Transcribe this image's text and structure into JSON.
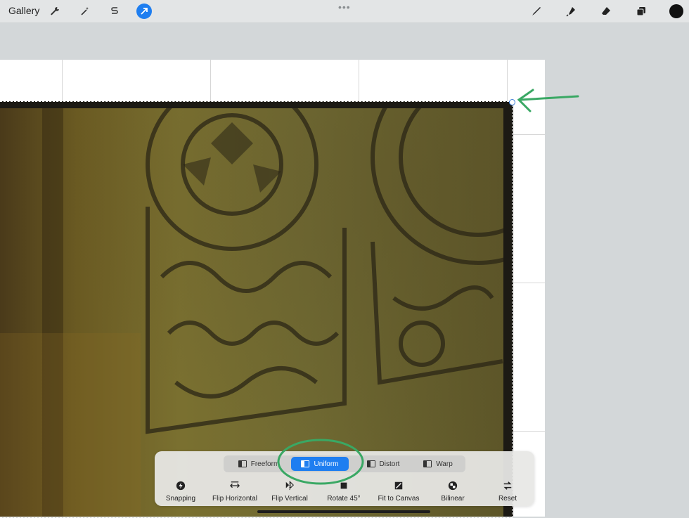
{
  "topbar": {
    "gallery_label": "Gallery",
    "left_icons": [
      "wrench-icon",
      "magic-wand-icon",
      "selection-s-icon",
      "transform-arrow-icon"
    ],
    "center_handle": "•••",
    "right_icons": [
      "brush-icon",
      "smudge-icon",
      "eraser-icon",
      "layers-icon"
    ],
    "color_swatch": "#111111",
    "accent": "#1e7ef0"
  },
  "transform": {
    "modes": [
      {
        "label": "Freeform",
        "active": false
      },
      {
        "label": "Uniform",
        "active": true
      },
      {
        "label": "Distort",
        "active": false
      },
      {
        "label": "Warp",
        "active": false
      }
    ],
    "tools": [
      {
        "label": "Snapping",
        "icon": "lightning-icon"
      },
      {
        "label": "Flip Horizontal",
        "icon": "flip-horizontal-icon"
      },
      {
        "label": "Flip Vertical",
        "icon": "flip-vertical-icon"
      },
      {
        "label": "Rotate 45°",
        "icon": "rotate-icon"
      },
      {
        "label": "Fit to Canvas",
        "icon": "fit-canvas-icon"
      },
      {
        "label": "Bilinear",
        "icon": "bilinear-icon"
      },
      {
        "label": "Reset",
        "icon": "reset-icon"
      }
    ]
  },
  "annotation_color": "#3aa864"
}
